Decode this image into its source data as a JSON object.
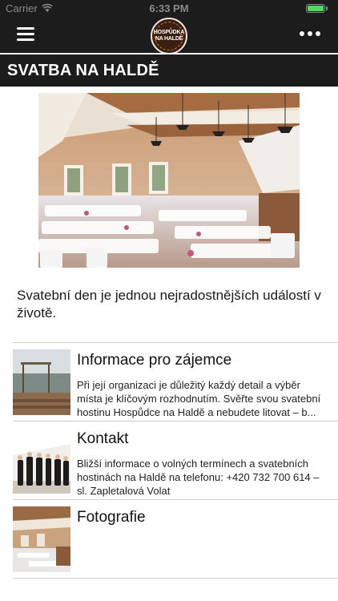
{
  "status_bar": {
    "carrier": "Carrier",
    "time": "6:33 PM",
    "battery_color": "#4cd964"
  },
  "nav": {
    "menu_icon": "hamburger-menu-icon",
    "logo_line1": "HOSPŮDKA",
    "logo_line2": "NA HALDĚ",
    "more_icon": "more-dots-icon"
  },
  "page": {
    "title": "SVATBA NA HALDĚ",
    "intro": "Svatební den je jednou nejradostnějších událostí v životě."
  },
  "items": [
    {
      "title": "Informace pro zájemce",
      "description": "Při její organizaci je důležitý každý detail a výběr místa je klíčovým rozhodnutím. Svěřte svou svatební hostinu  Hospůdce na Haldě a nebudete litovat – b..."
    },
    {
      "title": "Kontakt",
      "description": "Bližší informace o volných termínech a svatebních hostinách na Haldě na telefonu: +420 732 700 614 – sl. Zapletalová  Volat"
    },
    {
      "title": "Fotografie",
      "description": ""
    }
  ],
  "colors": {
    "header_bg": "#1c1c1c",
    "text": "#1a1a1a",
    "divider": "#cfcfcf"
  }
}
